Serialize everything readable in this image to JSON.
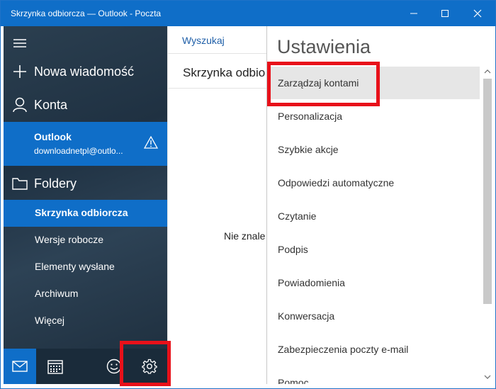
{
  "window": {
    "title": "Skrzynka odbiorcza — Outlook - Poczta",
    "controls": [
      "minimize-icon",
      "maximize-icon",
      "close-icon"
    ]
  },
  "nav": {
    "new_message": "Nowa wiadomość",
    "accounts": "Konta",
    "account": {
      "name": "Outlook",
      "email": "downloadnetpl@outlo..."
    },
    "folders_label": "Foldery",
    "folders": [
      "Skrzynka odbiorcza",
      "Wersje robocze",
      "Elementy wysłane",
      "Archiwum",
      "Więcej"
    ],
    "active_folder": "Skrzynka odbiorcza",
    "bottom_icons": [
      "mail-icon",
      "calendar-icon",
      "smiley-icon",
      "gear-icon"
    ]
  },
  "list": {
    "search": "Wyszukaj",
    "title": "Skrzynka odbio",
    "empty_text": "Nie znale"
  },
  "settings": {
    "title": "Ustawienia",
    "items": [
      "Zarządzaj kontami",
      "Personalizacja",
      "Szybkie akcje",
      "Odpowiedzi automatyczne",
      "Czytanie",
      "Podpis",
      "Powiadomienia",
      "Konwersacja",
      "Zabezpieczenia poczty e-mail",
      "Pomoc"
    ],
    "highlighted_item": "Zarządzaj kontami"
  },
  "colors": {
    "accent": "#0f6ec8",
    "highlight": "#e8111a"
  }
}
